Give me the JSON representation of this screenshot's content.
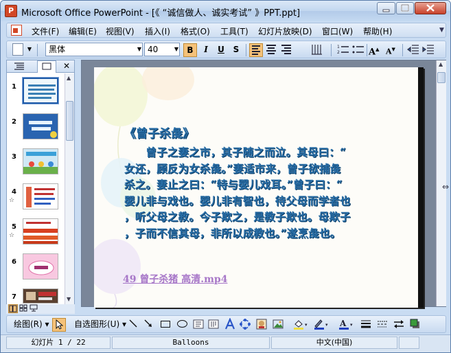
{
  "window": {
    "title": "Microsoft Office PowerPoint - [《 “诚信做人、诚实考试” 》PPT.ppt]",
    "app_icon": "P"
  },
  "menubar": {
    "items": [
      "文件(F)",
      "编辑(E)",
      "视图(V)",
      "插入(I)",
      "格式(O)",
      "工具(T)",
      "幻灯片放映(D)",
      "窗口(W)",
      "帮助(H)"
    ]
  },
  "format_toolbar": {
    "font": "黑体",
    "size": "40",
    "bold": "B",
    "italic": "I",
    "underline": "U",
    "shadow": "S",
    "grow_font": "A",
    "shrink_font": "A"
  },
  "left_pane": {
    "slide_numbers": [
      "1",
      "2",
      "3",
      "4",
      "5",
      "6",
      "7"
    ],
    "star_marker": "☆"
  },
  "slide": {
    "title": "《曾子杀彘》",
    "body_lines": [
      "　　曾子之妻之市，其子随之而泣。其母曰：“",
      "女还，顾反为女杀彘。”妻适市来，曾子欲捕彘",
      "杀之。妻止之曰：“特与婴儿戏耳。”曾子曰：“",
      "婴儿非与戏也。婴儿非有智也，待父母而学者也",
      "，听父母之教。今子欺之，是教子欺也。母欺子",
      "，子而不信其母，非所以成教也。”遂烹彘也。"
    ],
    "link": "49 曾子杀猪 高清.mp4"
  },
  "draw_toolbar": {
    "draw_label": "绘图(R)",
    "autoshape_label": "自选图形(U)"
  },
  "statusbar": {
    "slide_info": "幻灯片 1 / 22",
    "design": "Balloons",
    "language": "中文(中国)"
  },
  "colors": {
    "slide_text": "#2a6fa8",
    "link": "#a777c8",
    "highlight": "#f5c27a"
  }
}
